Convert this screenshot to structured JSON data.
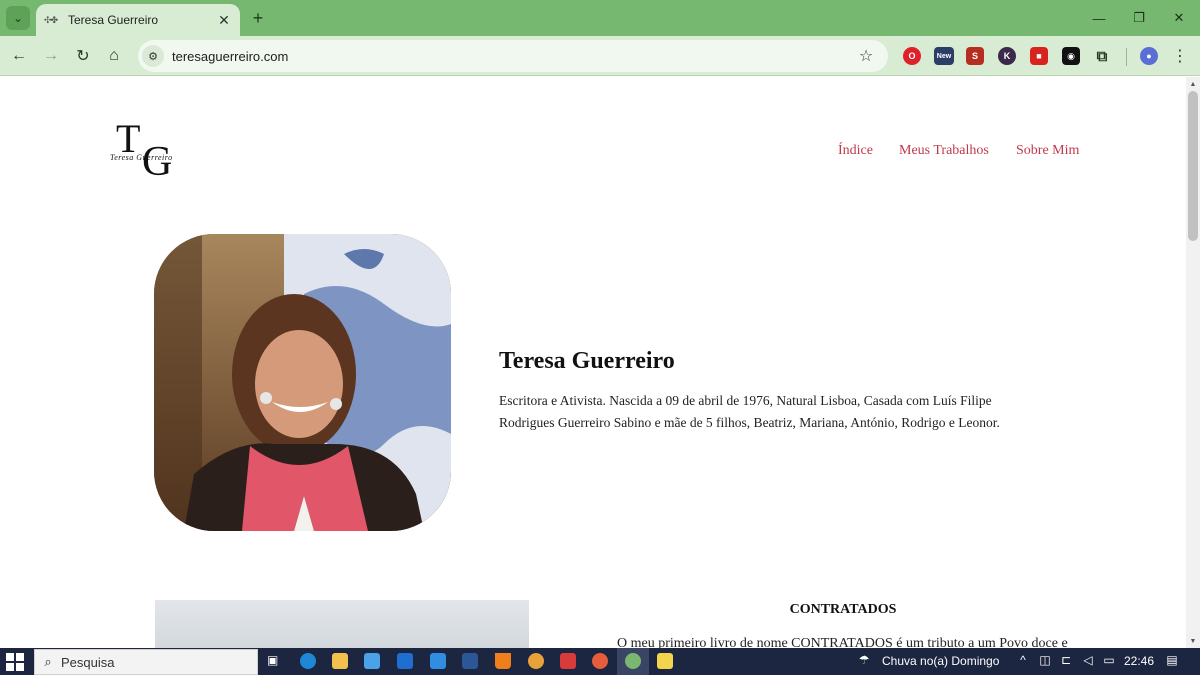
{
  "browser": {
    "tab": {
      "favicon": "✣✤",
      "title": "Teresa Guerreiro"
    },
    "url": "teresaguerreiro.com",
    "extension_badge": "New"
  },
  "page": {
    "logo": {
      "initial_t": "T",
      "initial_g": "G",
      "script": "Teresa Guerreiro"
    },
    "nav": [
      "Índice",
      "Meus Trabalhos",
      "Sobre Mim"
    ],
    "hero": {
      "name": "Teresa Guerreiro",
      "bio": "Escritora e Ativista. Nascida a 09 de abril de 1976, Natural Lisboa, Casada com Luís Filipe Rodrigues Guerreiro Sabino e mãe de 5 filhos, Beatriz, Mariana, António, Rodrigo e Leonor."
    },
    "book": {
      "title": "CONTRATADOS",
      "text": "O meu primeiro livro de nome CONTRATADOS é um tributo a um Povo doce e"
    }
  },
  "taskbar": {
    "search_placeholder": "Pesquisa",
    "weather": "Chuva no(a) Domingo",
    "time": "22:46"
  },
  "colors": {
    "accent": "#c0394b",
    "chrome": "#76b86f",
    "toolbar": "#d7ecd2",
    "taskbar": "#1d2640"
  }
}
